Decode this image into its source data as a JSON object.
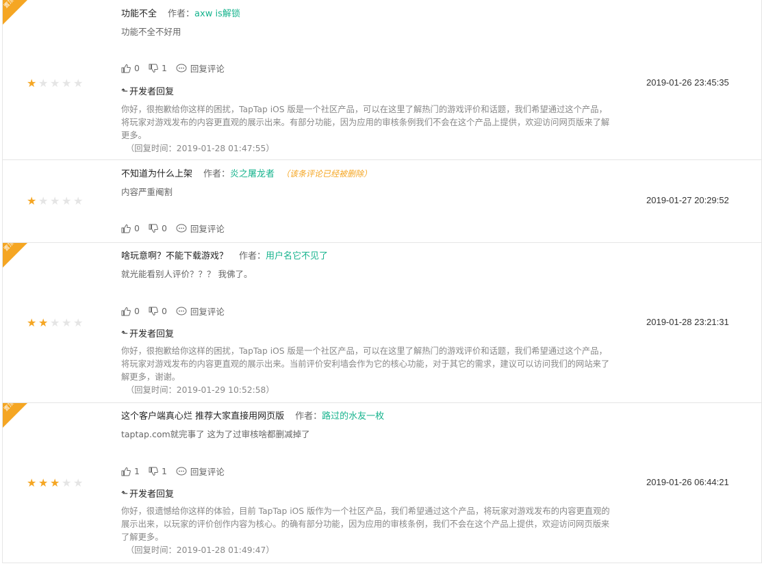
{
  "colors": {
    "star": "#f5a623",
    "star_off": "#e5e5e5",
    "author": "#16b38d",
    "pin": "#f5a623",
    "deleted": "#f5a623"
  },
  "labels": {
    "author": "作者：",
    "reply_comment": "回复评论",
    "dev_reply": "开发者回复",
    "pin": "置顶"
  },
  "reviews": [
    {
      "pinned": true,
      "title": "功能不全",
      "author": "axw is解锁",
      "body": "功能不全不好用",
      "likes": "0",
      "dislikes": "1",
      "rating": 1,
      "time": "2019-01-26 23:45:35",
      "dev_reply": "你好，很抱歉给你这样的困扰，TapTap iOS 版是一个社区产品，可以在这里了解热门的游戏评价和话题，我们希望通过这个产品，将玩家对游戏发布的内容更直观的展示出来。有部分功能，因为应用的审核条例我们不会在这个产品上提供，欢迎访问网页版来了解更多。",
      "dev_reply_time": "（回复时间：2019-01-28 01:47:55）"
    },
    {
      "pinned": false,
      "title": "不知道为什么上架",
      "author": "炎之屠龙者",
      "deleted_note": "（该条评论已经被删除）",
      "body": "内容严重阉割",
      "likes": "0",
      "dislikes": "0",
      "rating": 1,
      "time": "2019-01-27 20:29:52"
    },
    {
      "pinned": true,
      "title": "啥玩意啊？不能下载游戏？",
      "author": "用户名它不见了",
      "body": "就光能看别人评价？？？ 我佛了。",
      "likes": "0",
      "dislikes": "0",
      "rating": 2,
      "time": "2019-01-28 23:21:31",
      "dev_reply": "你好，很抱歉给你这样的困扰，TapTap iOS 版是一个社区产品，可以在这里了解热门的游戏评价和话题，我们希望通过这个产品，将玩家对游戏发布的内容更直观的展示出来。当前评价安利墙会作为它的核心功能，对于其它的需求，建议可以访问我们的网站来了解更多，谢谢。",
      "dev_reply_time": "（回复时间：2019-01-29 10:52:58）"
    },
    {
      "pinned": true,
      "title": "这个客户端真心烂 推荐大家直接用网页版",
      "author": "路过的水友一枚",
      "body": "taptap.com就完事了 这为了过审核啥都删减掉了",
      "likes": "1",
      "dislikes": "1",
      "rating": 3,
      "time": "2019-01-26 06:44:21",
      "dev_reply": "你好，很遗憾给你这样的体验，目前 TapTap iOS 版作为一个社区产品，我们希望通过这个产品，将玩家对游戏发布的内容更直观的展示出来，以玩家的评价创作内容为核心。的确有部分功能，因为应用的审核条例，我们不会在这个产品上提供，欢迎访问网页版来了解更多。",
      "dev_reply_time": "（回复时间：2019-01-28 01:49:47）"
    }
  ]
}
